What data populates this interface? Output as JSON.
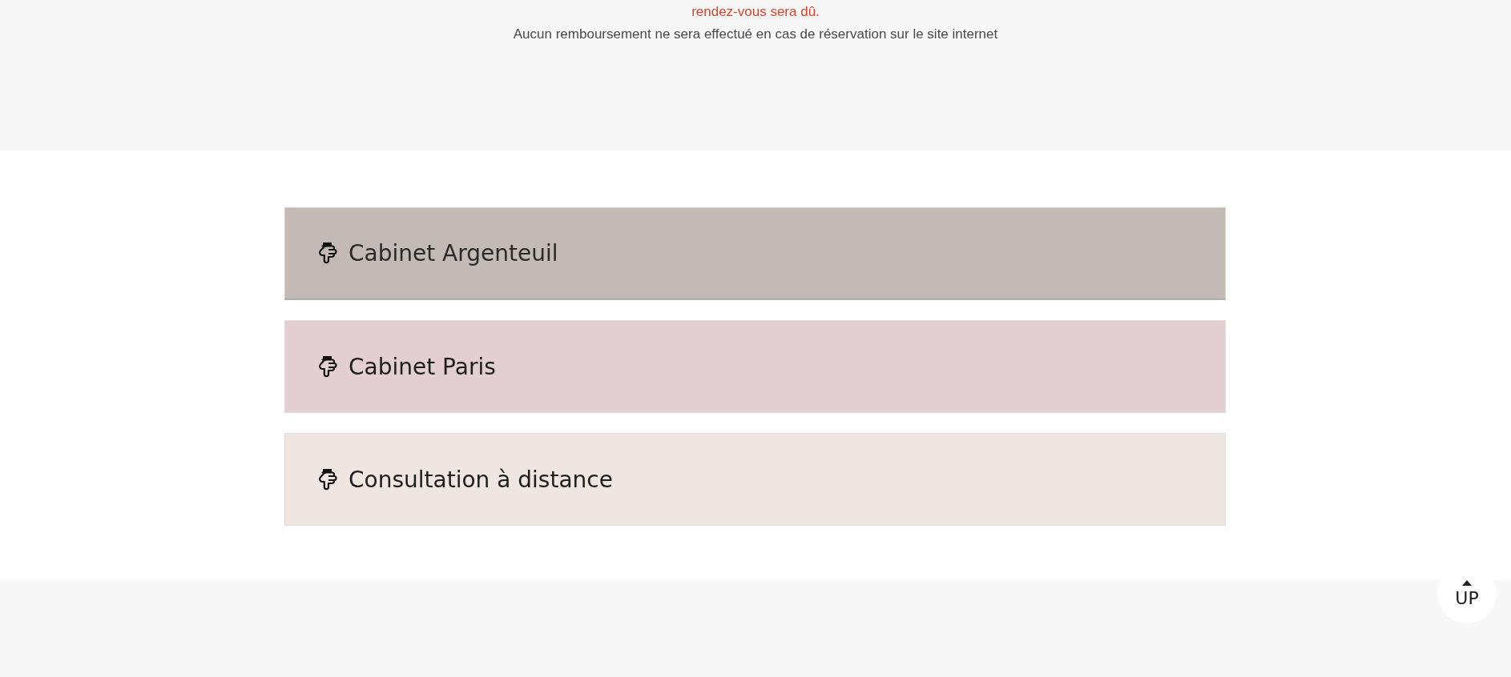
{
  "notice": {
    "lines": [
      {
        "kind": "warning",
        "text": "rendez-vous sera dû."
      },
      {
        "kind": "info",
        "text": "Aucun remboursement ne sera effectué en cas de réservation sur le site internet"
      }
    ]
  },
  "locations": [
    {
      "label": "Cabinet Argenteuil",
      "color": "#c3bab5",
      "hovered": true
    },
    {
      "label": "Cabinet Paris",
      "color": "#e3cfd3",
      "hovered": false
    },
    {
      "label": "Consultation à distance",
      "color": "#f0e6e1",
      "hovered": false
    }
  ],
  "back_to_top": {
    "label": "UP"
  }
}
